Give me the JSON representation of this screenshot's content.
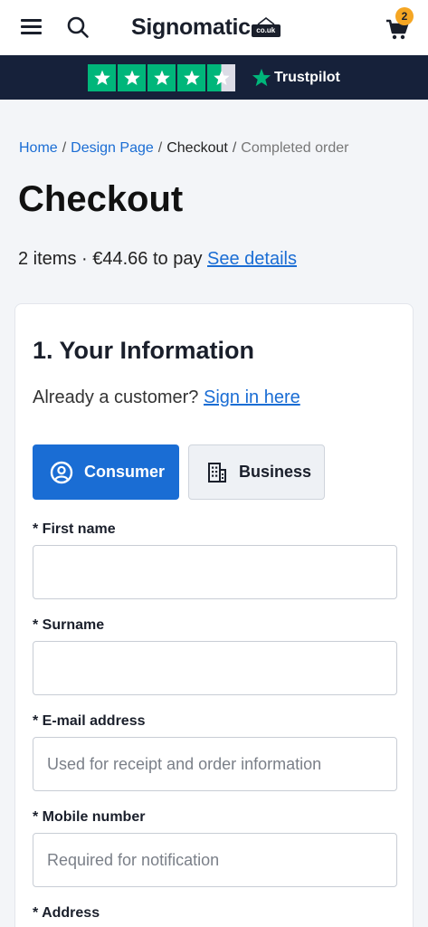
{
  "header": {
    "logo_text": "Signomatic",
    "logo_badge": "co.uk",
    "cart_count": "2"
  },
  "trustpilot": {
    "label": "Trustpilot",
    "rating_stars": 4.5
  },
  "breadcrumb": {
    "items": [
      "Home",
      "Design Page",
      "Checkout",
      "Completed order"
    ],
    "separator": "/"
  },
  "page": {
    "title": "Checkout",
    "summary": "2 items · €44.66 to pay",
    "details_link": "See details"
  },
  "form": {
    "section_title": "1. Your Information",
    "signin_prompt": "Already a customer?",
    "signin_link": "Sign in here",
    "customer_types": [
      "Consumer",
      "Business"
    ],
    "fields": [
      {
        "label": "* First name",
        "placeholder": "",
        "value": ""
      },
      {
        "label": "* Surname",
        "placeholder": "",
        "value": ""
      },
      {
        "label": "* E-mail address",
        "placeholder": "Used for receipt and order information",
        "value": ""
      },
      {
        "label": "* Mobile number",
        "placeholder": "Required for notification",
        "value": ""
      },
      {
        "label": "* Address",
        "placeholder": "",
        "value": ""
      }
    ]
  },
  "colors": {
    "accent": "#1a6dd4",
    "trust_bar": "#16213a",
    "trust_green": "#00b67a",
    "badge": "#f5a623"
  }
}
